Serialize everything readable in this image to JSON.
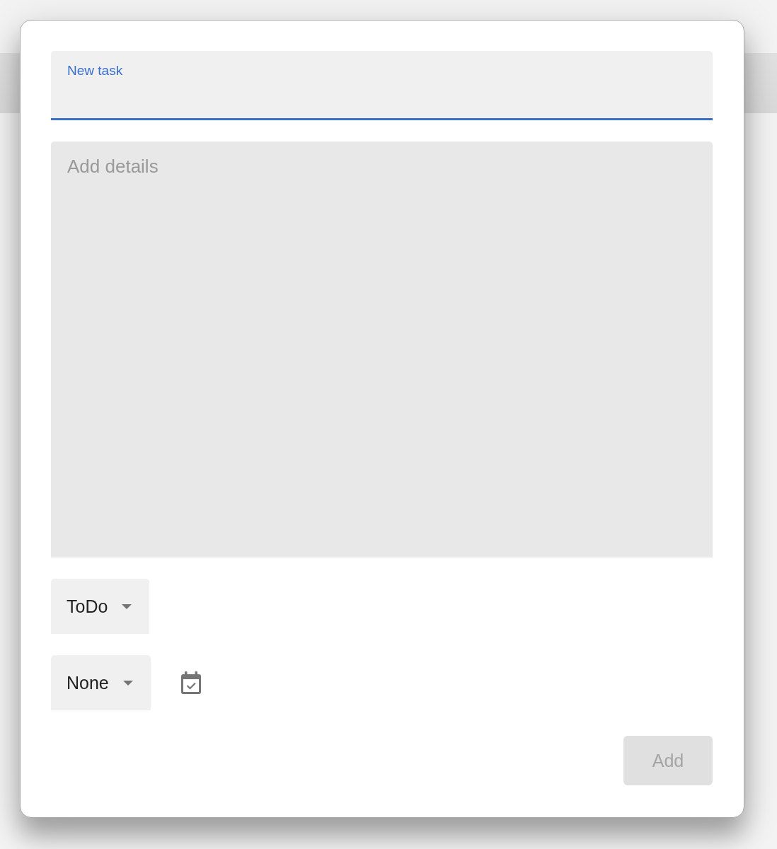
{
  "dialog": {
    "title_field": {
      "label": "New task",
      "focused": true
    },
    "details_field": {
      "placeholder": "Add details"
    },
    "rows": [
      {
        "kind": "select",
        "value": "ToDo"
      },
      {
        "kind": "select_with_date",
        "value": "None"
      }
    ],
    "add_button": {
      "label": "Add",
      "disabled": true
    }
  }
}
